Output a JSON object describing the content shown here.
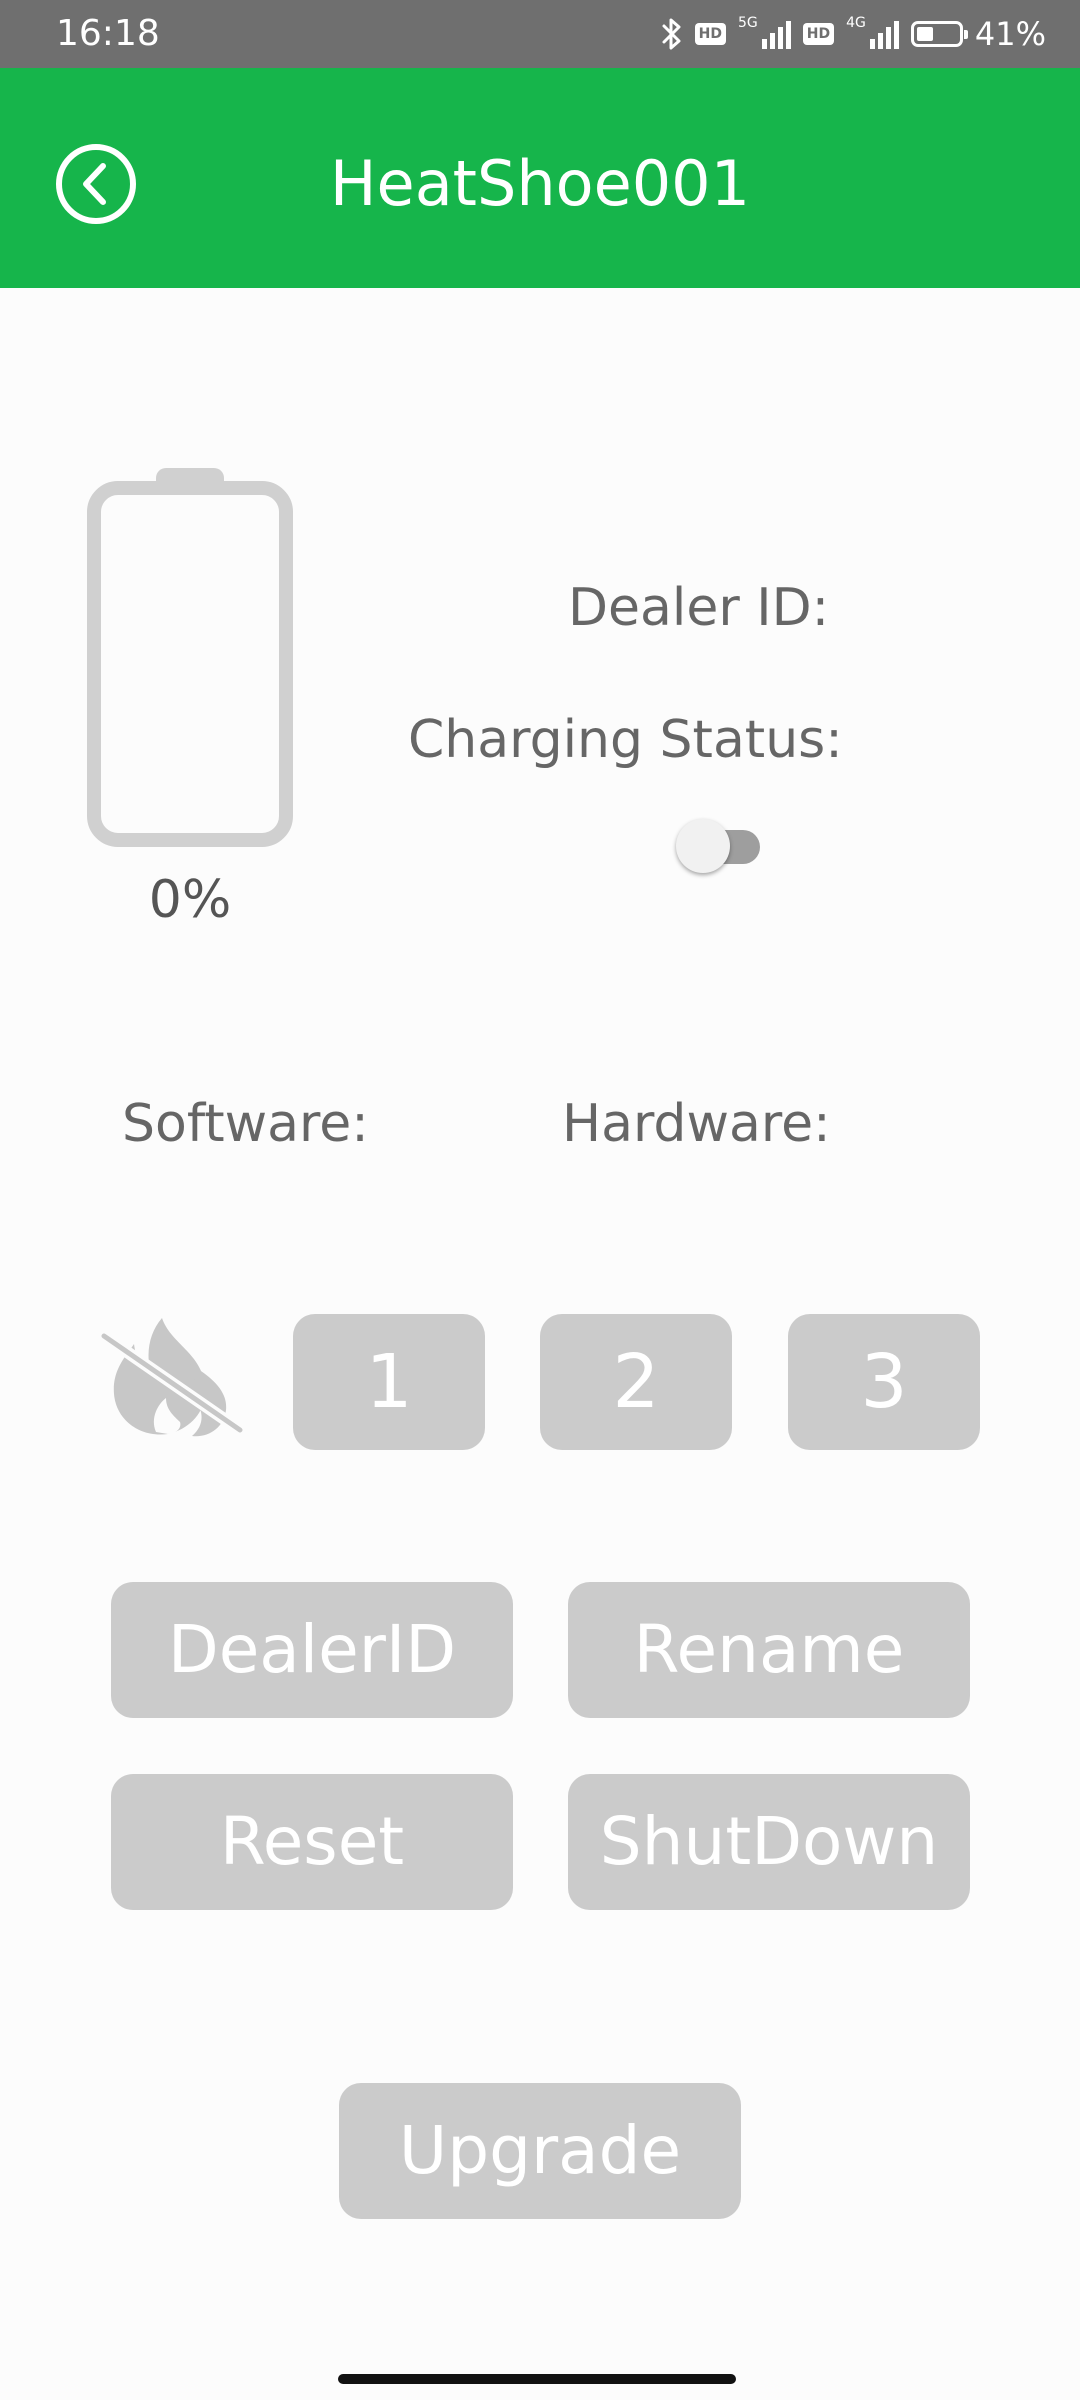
{
  "status_bar": {
    "time": "16:18",
    "badge_1": "HD",
    "net_1": "5G",
    "badge_2": "HD",
    "net_2": "4G",
    "battery_percent": "41%",
    "battery_level": 0.41,
    "icons": [
      "bluetooth-icon",
      "signal-icon",
      "battery-icon"
    ]
  },
  "header": {
    "title": "HeatShoe001",
    "back_icon": "circle-chevron-left-icon",
    "background_color": "#16b54b"
  },
  "device": {
    "battery_percent": "0%",
    "battery_level": 0,
    "dealer_id_label": "Dealer ID:",
    "charging_status_label": "Charging Status:",
    "charging_toggle_on": false,
    "software_label": "Software:",
    "hardware_label": "Hardware:"
  },
  "heat": {
    "icon": "fire-off-icon",
    "levels": [
      "1",
      "2",
      "3"
    ]
  },
  "actions": {
    "dealer_id": "DealerID",
    "rename": "Rename",
    "reset": "Reset",
    "shutdown": "ShutDown",
    "upgrade": "Upgrade"
  },
  "colors": {
    "accent_green": "#16b54b",
    "button_disabled": "#cbcbcb",
    "label_text": "#666666"
  }
}
